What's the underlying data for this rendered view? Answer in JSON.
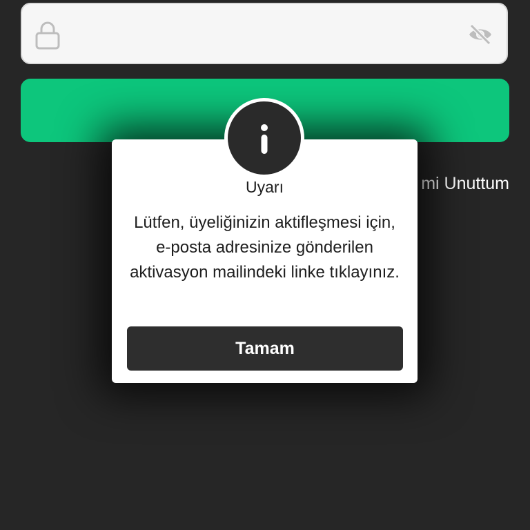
{
  "password_field": {
    "value": "",
    "placeholder": "",
    "lock_icon": "lock-icon",
    "visibility_icon": "eye-off-icon"
  },
  "login_button": {
    "label": "",
    "color": "#0dc67c"
  },
  "forgot_password": {
    "label": "mi Unuttum"
  },
  "alert": {
    "icon": "info-icon",
    "title": "Uyarı",
    "message": "Lütfen, üyeliğinizin aktifleşmesi için, e-posta adresinize gönderilen aktivasyon mailindeki linke tıklayınız.",
    "ok_label": "Tamam"
  },
  "colors": {
    "background": "#262626",
    "accent": "#0dc67c",
    "dialog": "#ffffff",
    "dark_button": "#2e2e2e"
  }
}
